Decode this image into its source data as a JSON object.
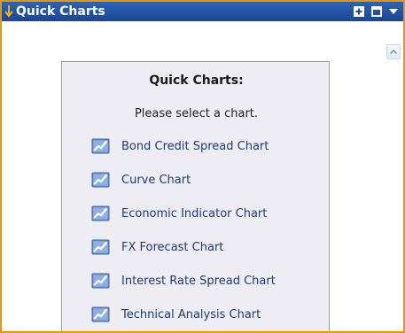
{
  "panel": {
    "title": "Quick Charts",
    "accent_color": "#E79A00",
    "titlebar_color": "#1F4B9E"
  },
  "titlebar_buttons": [
    {
      "name": "add-icon"
    },
    {
      "name": "maximize-icon"
    },
    {
      "name": "menu-dropdown-icon"
    }
  ],
  "content": {
    "heading": "Quick Charts:",
    "instruction": "Please select a chart.",
    "charts": [
      {
        "label": "Bond Credit Spread Chart",
        "icon": "chart-icon"
      },
      {
        "label": "Curve Chart",
        "icon": "chart-icon"
      },
      {
        "label": "Economic Indicator Chart",
        "icon": "chart-icon"
      },
      {
        "label": "FX Forecast Chart",
        "icon": "chart-icon"
      },
      {
        "label": "Interest Rate Spread Chart",
        "icon": "chart-icon"
      },
      {
        "label": "Technical Analysis Chart",
        "icon": "chart-icon"
      }
    ]
  }
}
